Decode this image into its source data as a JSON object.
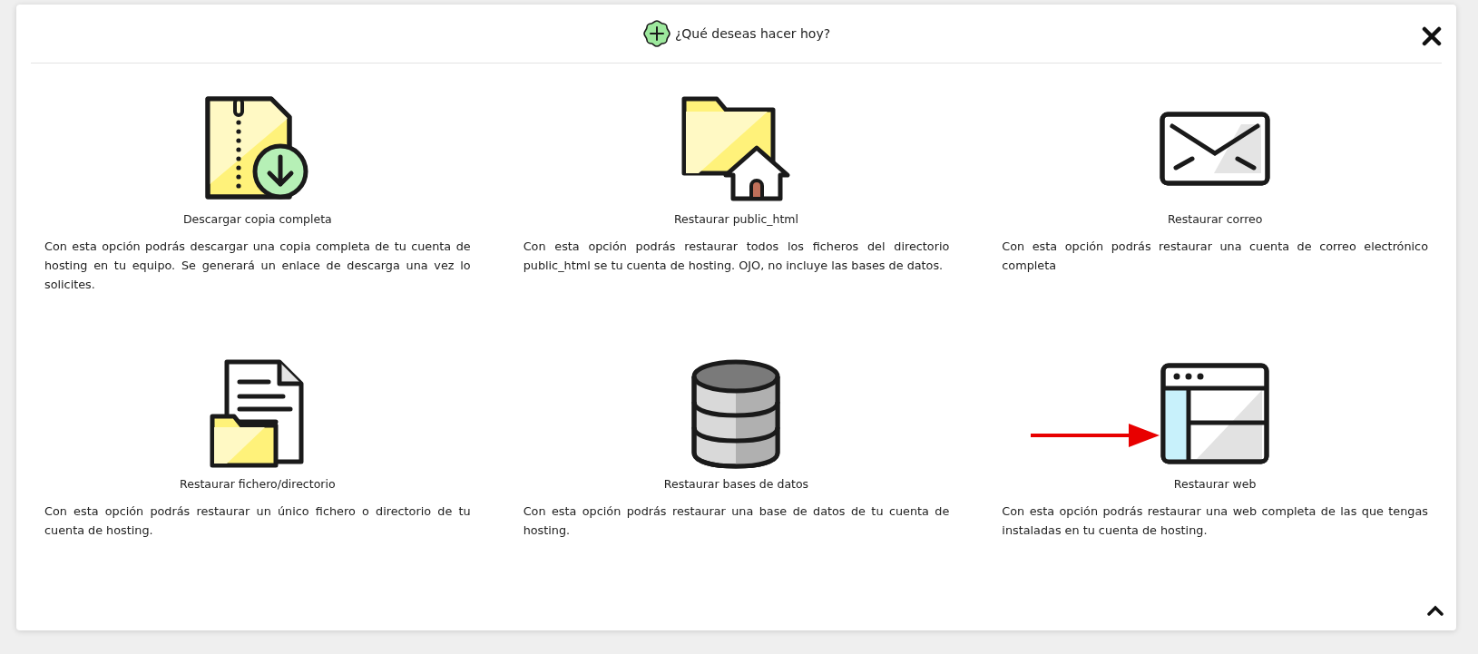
{
  "dialog": {
    "title": "¿Qué deseas hacer hoy?"
  },
  "options": [
    {
      "kind": "zip-download",
      "title": "Descargar copia completa",
      "description": "Con esta opción podrás descargar una copia completa de tu cuenta de hosting en tu equipo. Se generará un enlace de descarga una vez lo solicites.",
      "arrow": false
    },
    {
      "kind": "folder-home",
      "title": "Restaurar public_html",
      "description": "Con esta opción podrás restaurar todos los ficheros del directorio public_html se tu cuenta de hosting. OJO, no incluye las bases de datos.",
      "arrow": false
    },
    {
      "kind": "envelope",
      "title": "Restaurar correo",
      "description": "Con esta opción podrás restaurar una cuenta de correo electrónico completa",
      "arrow": false
    },
    {
      "kind": "file-folder",
      "title": "Restaurar fichero/directorio",
      "description": "Con esta opción podrás restaurar un único fichero o directorio de tu cuenta de hosting.",
      "arrow": false
    },
    {
      "kind": "database",
      "title": "Restaurar bases de datos",
      "description": "Con esta opción podrás restaurar una base de datos de tu cuenta de hosting.",
      "arrow": false
    },
    {
      "kind": "browser",
      "title": "Restaurar web",
      "description": "Con esta opción podrás restaurar una web completa de las que tengas instaladas en tu cuenta de hosting.",
      "arrow": true
    }
  ]
}
